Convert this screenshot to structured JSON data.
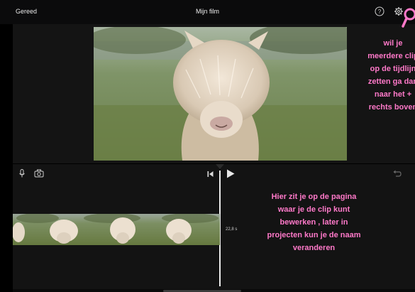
{
  "header": {
    "done_label": "Gereed",
    "title": "Mijn film"
  },
  "viewer": {
    "preview_image": "alpaca-video-frame"
  },
  "annotations": {
    "top_lines": [
      "wil je",
      "meerdere clip",
      "op de tijdlijn",
      "zetten ga dan",
      "naar het +",
      "rechts boven"
    ],
    "bottom_lines": [
      "Hier zit je op de pagina",
      "waar je de clip kunt",
      "bewerken , later in",
      "projecten kun je de naam",
      "veranderen"
    ]
  },
  "timeline": {
    "clip_duration": "22,8 s",
    "icons": [
      "mic-icon",
      "camera-icon",
      "skip-start-icon",
      "play-icon",
      "undo-icon"
    ]
  },
  "colors": {
    "annotation": "#ff79c9",
    "background": "#000000",
    "toolbar": "#0b0b0c"
  }
}
